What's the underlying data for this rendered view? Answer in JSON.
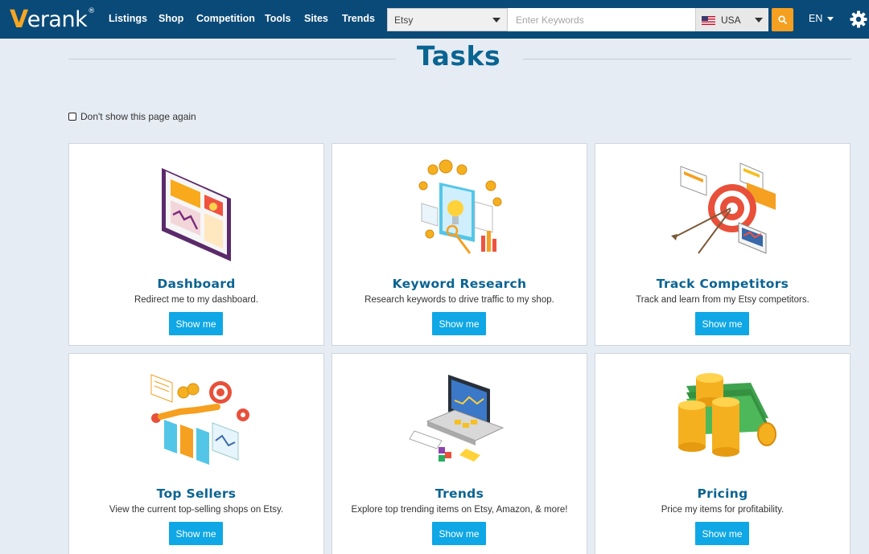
{
  "brand": {
    "logo_text": "erank",
    "logo_mark": "®"
  },
  "nav": {
    "items": [
      "Listings",
      "Shop",
      "Competition",
      "Tools",
      "Sites",
      "Trends"
    ],
    "site_select": "Etsy",
    "keyword_placeholder": "Enter Keywords",
    "country": "USA",
    "language": "EN"
  },
  "page": {
    "title": "Tasks",
    "dont_show_label": "Don't show this page again"
  },
  "cards": [
    {
      "title": "Dashboard",
      "desc": "Redirect me to my dashboard.",
      "button": "Show me"
    },
    {
      "title": "Keyword Research",
      "desc": "Research keywords to drive traffic to my shop.",
      "button": "Show me"
    },
    {
      "title": "Track Competitors",
      "desc": "Track and learn from my Etsy competitors.",
      "button": "Show me"
    },
    {
      "title": "Top Sellers",
      "desc": "View the current top-selling shops on Etsy.",
      "button": "Show me"
    },
    {
      "title": "Trends",
      "desc": "Explore top trending items on Etsy, Amazon, & more!",
      "button": "Show me"
    },
    {
      "title": "Pricing",
      "desc": "Price my items for profitability.",
      "button": "Show me"
    }
  ],
  "colors": {
    "navbar": "#0a4a78",
    "accent": "#f5a020",
    "button": "#0fa7e5",
    "title": "#0a6492"
  }
}
